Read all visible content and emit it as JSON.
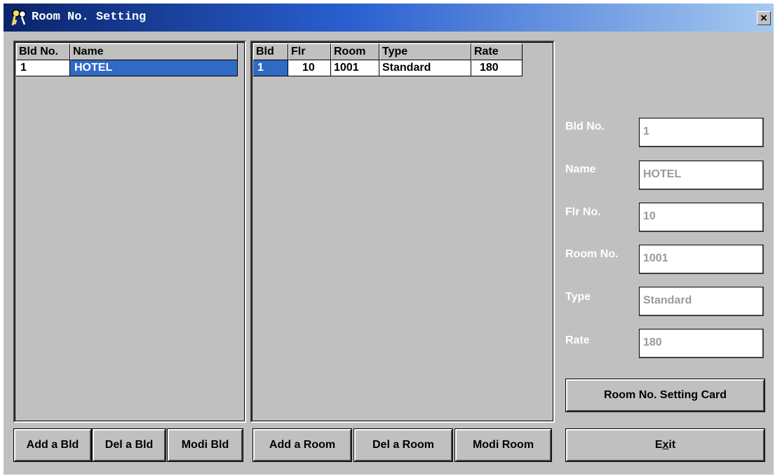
{
  "window": {
    "title": "Room No. Setting",
    "close_glyph": "×",
    "app_icon": "keys-icon"
  },
  "buildings": {
    "columns": [
      "Bld No.",
      "Name"
    ],
    "rows": [
      {
        "bld_no": "1",
        "name": "HOTEL"
      }
    ]
  },
  "rooms": {
    "columns": [
      "Bld",
      "Flr",
      "Room",
      "Type",
      "Rate"
    ],
    "rows": [
      {
        "bld": "1",
        "flr": "10",
        "room": "1001",
        "type": "Standard",
        "rate": "180"
      }
    ]
  },
  "details": {
    "bld_no": {
      "label": "Bld No.",
      "value": "1"
    },
    "name": {
      "label": "Name",
      "value": "HOTEL"
    },
    "flr_no": {
      "label": "Flr No.",
      "value": "10"
    },
    "room_no": {
      "label": "Room No.",
      "value": "1001"
    },
    "type": {
      "label": "Type",
      "value": "Standard"
    },
    "rate": {
      "label": "Rate",
      "value": "180"
    }
  },
  "buttons": {
    "add_bld": "Add a Bld",
    "del_bld": "Del a Bld",
    "modi_bld": "Modi Bld",
    "add_room": "Add a Room",
    "del_room": "Del a Room",
    "modi_room": "Modi Room",
    "setting_card": "Room No. Setting Card",
    "exit_pre": "E",
    "exit_mnemonic": "x",
    "exit_post": "it"
  },
  "colors": {
    "titlebar_start": "#0a246a",
    "titlebar_end": "#a6caf0",
    "selection": "#316ac5",
    "face": "#c0c0c0",
    "disabled_text": "#9a9a9a"
  }
}
